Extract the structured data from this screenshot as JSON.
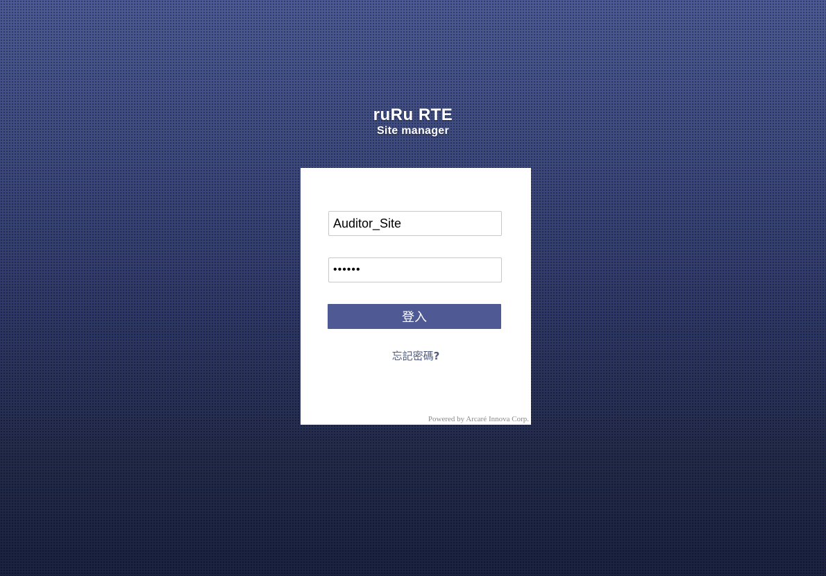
{
  "brand": {
    "title": "ruRu RTE",
    "subtitle": "Site manager"
  },
  "login": {
    "username_value": "Auditor_Site",
    "password_value": "••••••",
    "submit_label": "登入",
    "forgot_label": "忘記密碼",
    "forgot_mark": "?",
    "powered_by": "Powered by Arcaré Innova Corp."
  },
  "colors": {
    "background_top": "#4b5a94",
    "background_bottom": "#1b2140",
    "button": "#4f5a95",
    "panel": "#ffffff"
  }
}
